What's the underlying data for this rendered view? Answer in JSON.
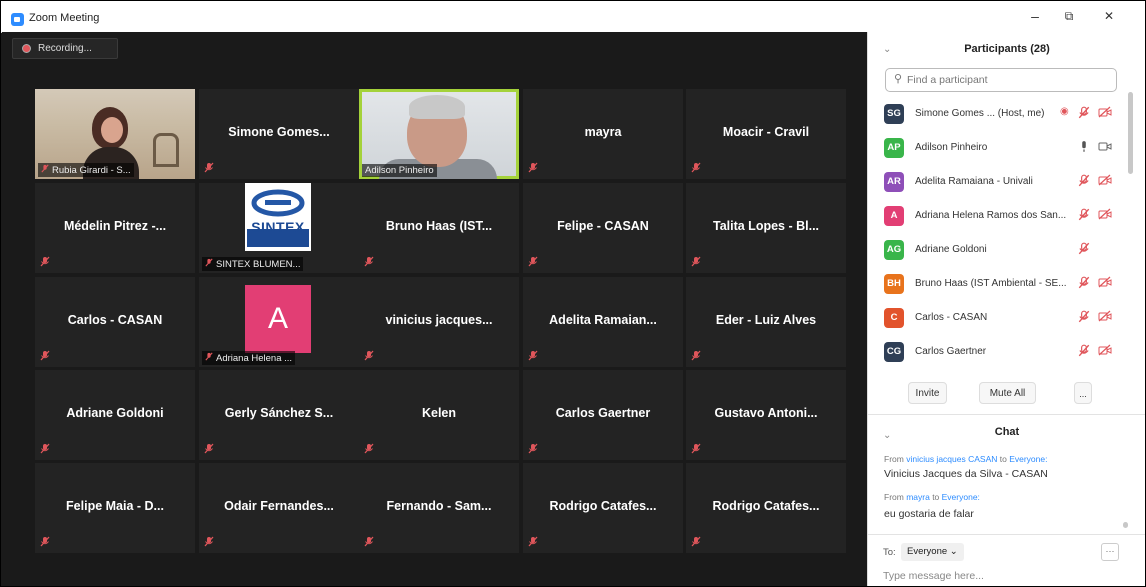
{
  "window": {
    "title": "Zoom Meeting",
    "minimize": "–",
    "restore": "⧉",
    "close": "✕"
  },
  "recording": {
    "label": "Recording..."
  },
  "tiles": [
    {
      "name": "Rubia Girardi - S...",
      "type": "video-woman"
    },
    {
      "name": "Simone Gomes...",
      "type": "name"
    },
    {
      "name": "Adilson Pinheiro",
      "type": "video-man",
      "active": true
    },
    {
      "name": "mayra",
      "type": "name"
    },
    {
      "name": "Moacir - Cravil",
      "type": "name"
    },
    {
      "name": "Médelin Pitrez -...",
      "type": "name"
    },
    {
      "name": "SINTEX BLUMEN...",
      "type": "logo",
      "logo_text": "SINTEX"
    },
    {
      "name": "Bruno Haas (IST...",
      "type": "name"
    },
    {
      "name": "Felipe - CASAN",
      "type": "name"
    },
    {
      "name": "Talita Lopes - Bl...",
      "type": "name"
    },
    {
      "name": "Carlos - CASAN",
      "type": "name"
    },
    {
      "name": "Adriana Helena ...",
      "type": "avatar",
      "avatar_letter": "A"
    },
    {
      "name": "vinicius jacques...",
      "type": "name"
    },
    {
      "name": "Adelita Ramaian...",
      "type": "name"
    },
    {
      "name": "Eder - Luiz Alves",
      "type": "name"
    },
    {
      "name": "Adriane Goldoni",
      "type": "name"
    },
    {
      "name": "Gerly Sánchez S...",
      "type": "name"
    },
    {
      "name": "Kelen",
      "type": "name"
    },
    {
      "name": "Carlos Gaertner",
      "type": "name"
    },
    {
      "name": "Gustavo Antoni...",
      "type": "name"
    },
    {
      "name": "Felipe Maia - D...",
      "type": "name"
    },
    {
      "name": "Odair Fernandes...",
      "type": "name"
    },
    {
      "name": "Fernando - Sam...",
      "type": "name"
    },
    {
      "name": "Rodrigo Catafes...",
      "type": "name"
    },
    {
      "name": "Rodrigo Catafes...",
      "type": "name"
    }
  ],
  "participants": {
    "title": "Participants (28)",
    "search_placeholder": "Find a participant",
    "list": [
      {
        "initials": "SG",
        "color": "#2f3f56",
        "name": "Simone Gomes ...  (Host, me)",
        "mic": "muted",
        "cam": "off",
        "recording": true
      },
      {
        "initials": "AP",
        "color": "#39b54a",
        "name": "Adilson Pinheiro",
        "mic": "on",
        "cam": "on"
      },
      {
        "initials": "AR",
        "color": "#8e4fb8",
        "name": "Adelita Ramaiana - Univali",
        "mic": "muted",
        "cam": "off"
      },
      {
        "initials": "A",
        "color": "#e23e74",
        "name": "Adriana Helena Ramos dos San...",
        "mic": "muted",
        "cam": "off"
      },
      {
        "initials": "AG",
        "color": "#39b54a",
        "name": "Adriane Goldoni",
        "mic": "muted",
        "cam": "none"
      },
      {
        "initials": "BH",
        "color": "#e8731c",
        "name": "Bruno Haas (IST Ambiental - SE...",
        "mic": "muted",
        "cam": "off"
      },
      {
        "initials": "C",
        "color": "#e2532c",
        "name": "Carlos - CASAN",
        "mic": "muted",
        "cam": "off"
      },
      {
        "initials": "CG",
        "color": "#2f3f56",
        "name": "Carlos Gaertner",
        "mic": "muted",
        "cam": "off"
      }
    ],
    "invite_label": "Invite",
    "mute_all_label": "Mute All",
    "more_label": "..."
  },
  "chat": {
    "title": "Chat",
    "messages": [
      {
        "from_prefix": "From ",
        "sender": "vinicius jacques CASAN",
        "to_word": " to ",
        "recipient": "Everyone:",
        "text": "Vinicius Jacques da Silva - CASAN"
      },
      {
        "from_prefix": "From ",
        "sender": "mayra",
        "to_word": " to ",
        "recipient": "Everyone:",
        "text": "eu gostaria de falar"
      }
    ],
    "to_label": "To:",
    "recipient_select": "Everyone ⌄",
    "more_label": "···",
    "input_placeholder": "Type message here..."
  },
  "colors": {
    "accent": "#2d8cff",
    "muted_red": "#e0565b",
    "active_speaker": "#a4d23a"
  }
}
